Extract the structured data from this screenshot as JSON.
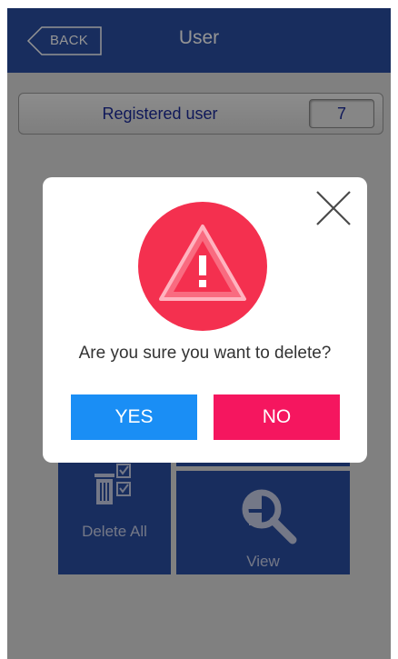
{
  "header": {
    "back_label": "BACK",
    "title": "User",
    "bg_color": "#2a4fa3"
  },
  "registered": {
    "label": "Registered user",
    "count": "7"
  },
  "tiles": {
    "delete_all_label": "Delete All",
    "view_label": "View",
    "delete_all_icon": "trash-checklist-icon",
    "view_icon": "magnifier-icon"
  },
  "dialog": {
    "message": "Are you sure you want to delete?",
    "yes_label": "YES",
    "no_label": "NO",
    "warning_icon": "warning-triangle-icon",
    "close_icon": "close-icon",
    "warning_color": "#f4304f",
    "yes_color": "#1a8ef5",
    "no_color": "#f5165f"
  }
}
